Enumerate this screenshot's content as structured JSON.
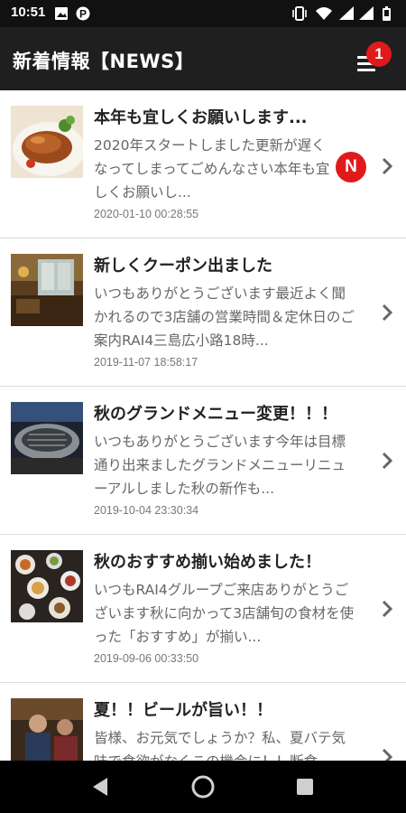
{
  "status_bar": {
    "time": "10:51",
    "left_icons": [
      "image-icon",
      "parking-icon"
    ],
    "right_icons": [
      "vibrate-icon",
      "wifi-icon",
      "signal-icon",
      "battery-icon"
    ]
  },
  "app_bar": {
    "title": "新着情報【NEWS】",
    "menu_badge_count": "1",
    "badge_color": "#e01a1a"
  },
  "news_items": [
    {
      "title": "本年も宜しくお願いします...",
      "body": "2020年スタートしました更新が遅くなってしまってごめんなさい本年も宜しくお願いし...",
      "date": "2020-01-10 00:28:55",
      "new_badge": "N",
      "thumbnail": "steak-dish-image"
    },
    {
      "title": "新しくクーポン出ました",
      "body": "いつもありがとうございます最近よく聞かれるので3店舗の営業時間＆定休日のご案内RAI4三島広小路18時...",
      "date": "2019-11-07 18:58:17",
      "thumbnail": "restaurant-interior-image"
    },
    {
      "title": "秋のグランドメニュー変更！！！",
      "body": "いつもありがとうございます今年は目標通り出来ましたグランドメニューリニューアルしました秋の新作も...",
      "date": "2019-10-04 23:30:34",
      "thumbnail": "grilled-dish-image"
    },
    {
      "title": "秋のおすすめ揃い始めました！",
      "body": "いつもRAI4グループご来店ありがとうございます秋に向かって3店舗旬の食材を使った「おすすめ」が揃い...",
      "date": "2019-09-06 00:33:50",
      "thumbnail": "food-spread-image"
    },
    {
      "title": "夏！！ビールが旨い！！",
      "body": "皆様、お元気でしょうか？私、夏バテ気味で食欲がなくこの機会に！！断食...",
      "date": "",
      "thumbnail": "people-bar-image"
    }
  ],
  "nav_bar": {
    "buttons": [
      "back-icon",
      "home-icon",
      "recents-icon"
    ]
  }
}
